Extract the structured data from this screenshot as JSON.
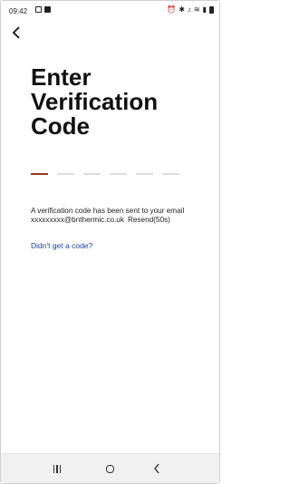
{
  "status_bar": {
    "time": "09:42",
    "icons_left": [
      "image-icon",
      "message-icon"
    ],
    "icons_right": [
      "alarm-icon",
      "bluetooth-icon",
      "mute-icon",
      "wifi-icon",
      "signal-icon",
      "battery-icon"
    ]
  },
  "header": {
    "back_icon": "chevron-left-icon"
  },
  "page": {
    "title": "Enter Verification Code",
    "code_slots": 6,
    "active_slot": 1,
    "info_text": "A verification code has been sent to your email",
    "email": "xxxxxxxxx@bnthermic.co.uk",
    "resend_label": "Resend(50s)",
    "no_code_link": "Didn't get a code?"
  },
  "colors": {
    "accent_underline": "#8a3b21",
    "link": "#1e40a6",
    "inactive_underline": "#dcdcdc"
  },
  "nav_bar": {
    "buttons": [
      "recent-apps",
      "home",
      "back"
    ]
  }
}
